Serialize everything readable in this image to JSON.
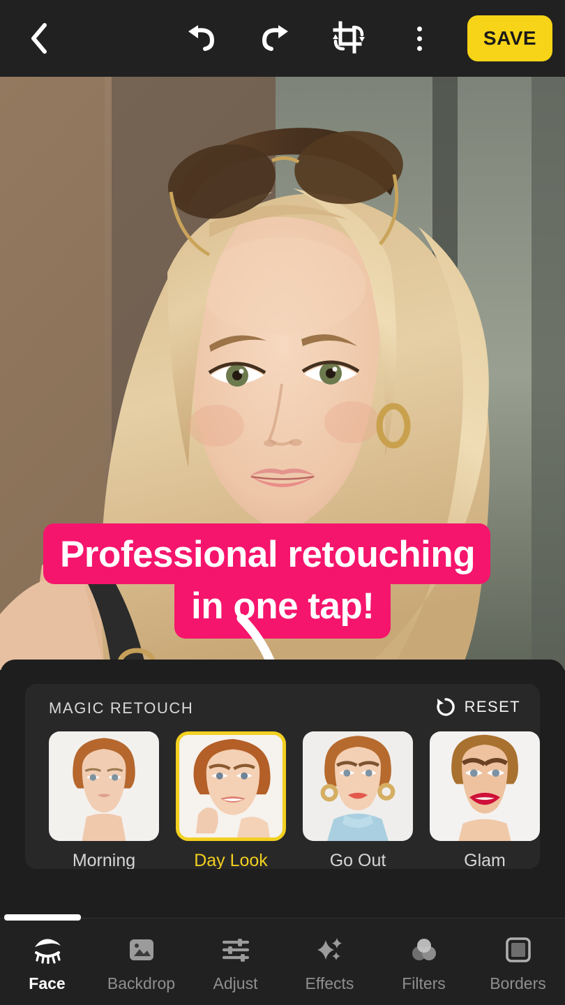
{
  "app": {
    "accent_yellow": "#f7d417",
    "accent_pink": "#f5156c",
    "panel_bg": "#1e1e1e",
    "card_bg": "#282828"
  },
  "topbar": {
    "back_icon": "chevron-left-icon",
    "undo_icon": "undo-icon",
    "redo_icon": "redo-icon",
    "crop_icon": "crop-rotate-icon",
    "more_icon": "more-vertical-icon",
    "save_label": "SAVE"
  },
  "photo": {
    "description": "blonde woman portrait with sunglasses on head"
  },
  "promo": {
    "line1": "Professional retouching",
    "line2": "in one tap!",
    "arrow_icon": "curved-arrow-down-icon"
  },
  "panel": {
    "title": "MAGIC RETOUCH",
    "reset_label": "RESET",
    "reset_icon": "rotate-ccw-icon",
    "presets": [
      {
        "label": "Morning",
        "selected": false
      },
      {
        "label": "Day Look",
        "selected": true
      },
      {
        "label": "Go Out",
        "selected": false
      },
      {
        "label": "Glam",
        "selected": false
      }
    ]
  },
  "navbar": {
    "items": [
      {
        "label": "Face",
        "icon": "eye-brow-icon",
        "active": true
      },
      {
        "label": "Backdrop",
        "icon": "image-icon",
        "active": false
      },
      {
        "label": "Adjust",
        "icon": "sliders-icon",
        "active": false
      },
      {
        "label": "Effects",
        "icon": "sparkles-icon",
        "active": false
      },
      {
        "label": "Filters",
        "icon": "circles-icon",
        "active": false
      },
      {
        "label": "Borders",
        "icon": "frame-icon",
        "active": false
      }
    ]
  }
}
